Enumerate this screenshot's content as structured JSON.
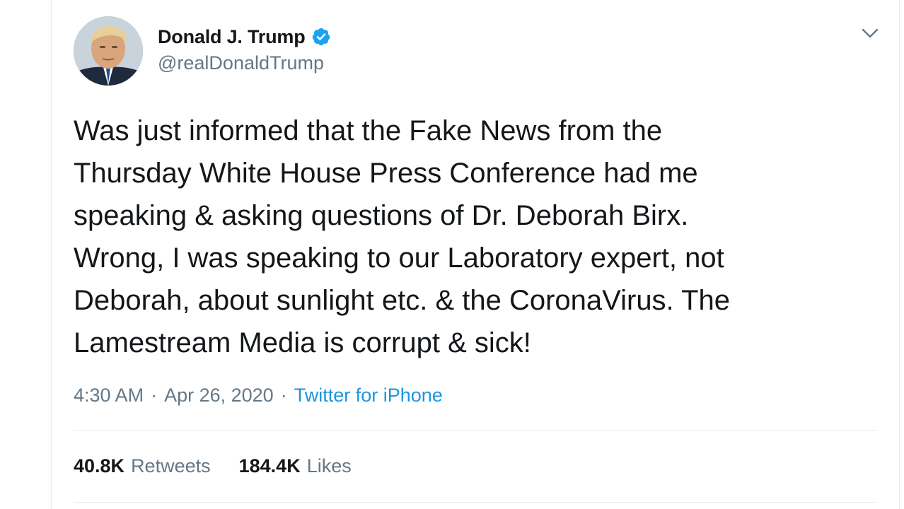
{
  "author": {
    "display_name": "Donald J. Trump",
    "handle": "@realDonaldTrump",
    "verified": true
  },
  "tweet": {
    "text": "Was just informed that the Fake News from the\nThursday White House Press Conference had me\nspeaking & asking questions of Dr. Deborah Birx.\nWrong, I was speaking to our Laboratory expert, not\nDeborah, about sunlight etc. & the CoronaVirus. The\nLamestream Media is corrupt & sick!",
    "time": "4:30 AM",
    "date": "Apr 26, 2020",
    "separator": "·",
    "source": "Twitter for iPhone"
  },
  "stats": {
    "retweets_count": "40.8K",
    "retweets_label": "Retweets",
    "likes_count": "184.4K",
    "likes_label": "Likes"
  },
  "icons": {
    "verified": "verified-badge-icon",
    "menu": "chevron-down-icon"
  },
  "colors": {
    "text": "#14171a",
    "secondary": "#657786",
    "link": "#1b95e0",
    "verified": "#1da1f2",
    "divider": "#e6ecf0"
  }
}
